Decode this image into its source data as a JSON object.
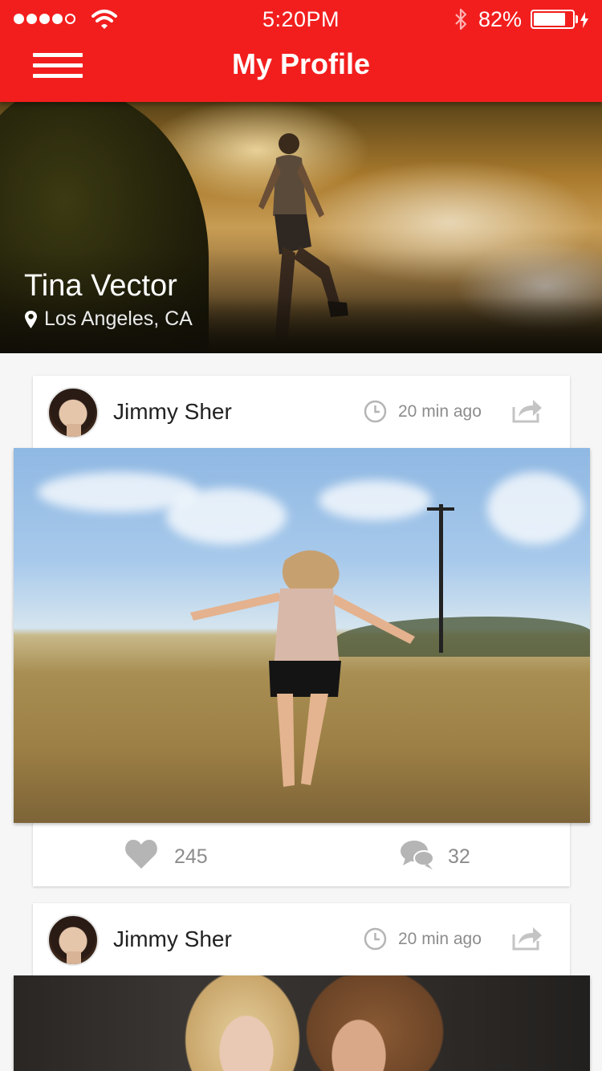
{
  "status_bar": {
    "time": "5:20PM",
    "battery_percent": "82%",
    "signal_bars_filled": 4,
    "signal_bars_total": 5,
    "battery_level": 0.82
  },
  "header": {
    "title": "My Profile",
    "menu_icon": "hamburger-menu-icon",
    "background_color": "#f21e1e"
  },
  "profile": {
    "name": "Tina Vector",
    "location": "Los Angeles, CA",
    "location_icon": "map-pin-icon"
  },
  "posts": [
    {
      "author": "Jimmy Sher",
      "time_ago": "20 min ago",
      "likes": "245",
      "comments": "32"
    },
    {
      "author": "Jimmy Sher",
      "time_ago": "20 min ago"
    }
  ],
  "colors": {
    "accent": "#f21e1e",
    "muted_text": "#8c8c8c",
    "icon_gray": "#b5b5b5"
  }
}
